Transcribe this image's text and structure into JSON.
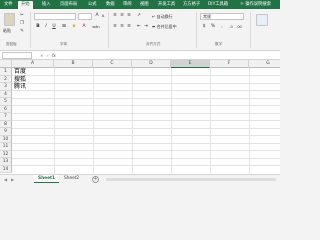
{
  "ribbon_tabs": [
    "文件",
    "开始",
    "插入",
    "页面布局",
    "公式",
    "数据",
    "审阅",
    "视图",
    "开发工具",
    "方方格子",
    "DIY工具箱",
    "操作说明搜索"
  ],
  "active_tab": "开始",
  "clipboard": {
    "paste_label": "粘贴",
    "group_label": "剪贴板"
  },
  "font": {
    "group_label": "字体",
    "bold": "B",
    "italic": "I",
    "underline": "U",
    "font_color_glyph": "A",
    "wen_glyph": "wén"
  },
  "alignment": {
    "group_label": "对齐方式",
    "wrap_text": "自动换行",
    "merge_center": "合并后居中"
  },
  "number": {
    "group_label": "数字",
    "format_value": "常规",
    "currency": "$",
    "percent": "%",
    "comma": ","
  },
  "formula_bar": {
    "namebox": "",
    "fx": "fx",
    "cancel": "×",
    "confirm": "✓"
  },
  "columns": [
    "A",
    "B",
    "C",
    "D",
    "E",
    "F",
    "G"
  ],
  "selected_column": "E",
  "rows": [
    "1",
    "2",
    "3",
    "4",
    "5",
    "6",
    "7",
    "8",
    "9",
    "10",
    "11",
    "12",
    "13",
    "14"
  ],
  "cells": {
    "A1": "百度",
    "A2": "搜狐",
    "A3": "腾讯"
  },
  "sheets": [
    "Sheet1",
    "Sheet2"
  ],
  "active_sheet": "Sheet1",
  "add_sheet": "+",
  "colors": {
    "accent": "#217346"
  }
}
